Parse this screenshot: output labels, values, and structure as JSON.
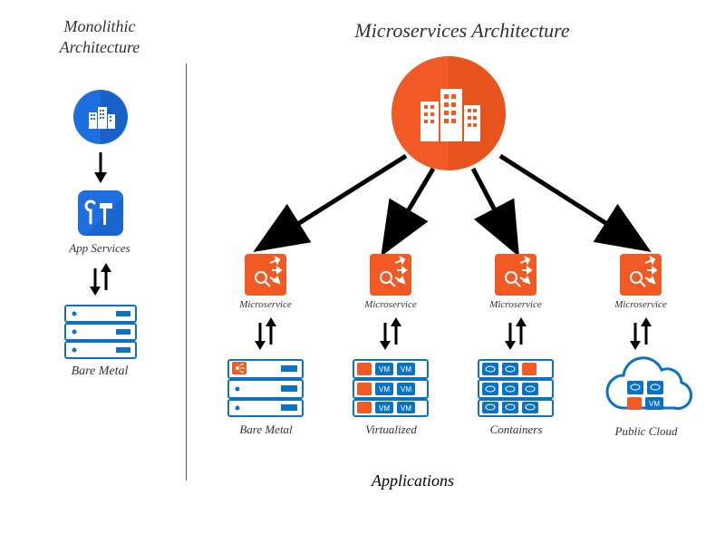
{
  "left": {
    "title_line1": "Monolithic",
    "title_line2": "Architecture",
    "app_services_label": "App Services",
    "bare_metal_label": "Bare Metal"
  },
  "right": {
    "title": "Microservices Architecture",
    "microservice_label": "Microservice",
    "deployments": {
      "bare_metal": "Bare Metal",
      "virtualized": "Virtualized",
      "containers": "Containers",
      "public_cloud": "Public Cloud"
    },
    "footer": "Applications"
  },
  "colors": {
    "blue": "#1d6fe0",
    "blue_dark": "#1452a8",
    "orange": "#f15a24",
    "orange_dark": "#d04710",
    "server_blue": "#0b72c4",
    "outline": "#0b72c4"
  }
}
